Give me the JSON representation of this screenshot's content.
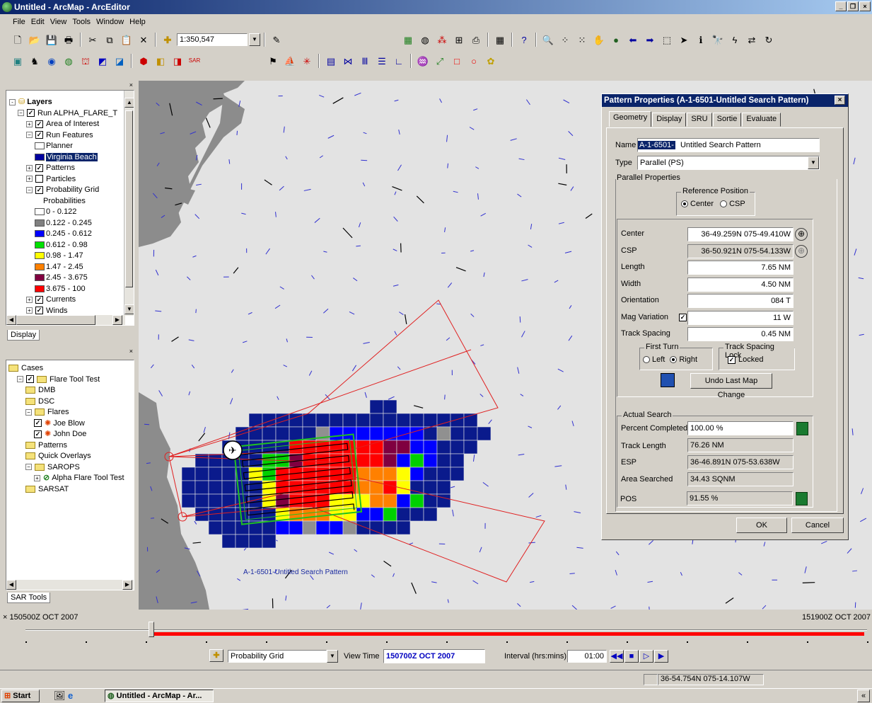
{
  "window": {
    "title": "Untitled - ArcMap - ArcEditor"
  },
  "menu": [
    "File",
    "Edit",
    "View",
    "Tools",
    "Window",
    "Help"
  ],
  "toolbar": {
    "scale": "1:350,547"
  },
  "layers": {
    "root": "Layers",
    "items": [
      {
        "label": "Run ALPHA_FLARE_T",
        "indent": 1,
        "pm": "-",
        "cb": "✓"
      },
      {
        "label": "Area of Interest",
        "indent": 2,
        "pm": "+",
        "cb": "✓"
      },
      {
        "label": "Run Features",
        "indent": 2,
        "pm": "-",
        "cb": "✓"
      },
      {
        "label": "Planner",
        "indent": 3,
        "swatch": "#ffffff"
      },
      {
        "label": "Virginia Beach",
        "indent": 3,
        "swatch": "#0000a0",
        "selected": true
      },
      {
        "label": "Patterns",
        "indent": 2,
        "pm": "+",
        "cb": "✓"
      },
      {
        "label": "Particles",
        "indent": 2,
        "pm": "+",
        "cb": ""
      },
      {
        "label": "Probability Grid",
        "indent": 2,
        "pm": "-",
        "cb": "✓"
      },
      {
        "label": "Probabilities",
        "indent": 4
      },
      {
        "label": "0 - 0.122",
        "indent": 3,
        "swatch": "#ffffff"
      },
      {
        "label": "0.122 - 0.245",
        "indent": 3,
        "swatch": "#808080"
      },
      {
        "label": "0.245 - 0.612",
        "indent": 3,
        "swatch": "#0000ff"
      },
      {
        "label": "0.612 - 0.98",
        "indent": 3,
        "swatch": "#00e000"
      },
      {
        "label": "0.98 - 1.47",
        "indent": 3,
        "swatch": "#ffff00"
      },
      {
        "label": "1.47 - 2.45",
        "indent": 3,
        "swatch": "#ff8000"
      },
      {
        "label": "2.45 - 3.675",
        "indent": 3,
        "swatch": "#800040"
      },
      {
        "label": "3.675 - 100",
        "indent": 3,
        "swatch": "#ff0000"
      },
      {
        "label": "Currents",
        "indent": 2,
        "pm": "+",
        "cb": "✓"
      },
      {
        "label": "Winds",
        "indent": 2,
        "pm": "+",
        "cb": "✓"
      }
    ],
    "tab": "Display"
  },
  "sar": {
    "items": [
      {
        "label": "Cases",
        "indent": 0,
        "type": "folder"
      },
      {
        "label": "Flare Tool Test",
        "indent": 1,
        "pm": "-",
        "cb": "✓",
        "type": "folder"
      },
      {
        "label": "DMB",
        "indent": 2,
        "type": "folder"
      },
      {
        "label": "DSC",
        "indent": 2,
        "type": "folder"
      },
      {
        "label": "Flares",
        "indent": 2,
        "pm": "-",
        "type": "folder"
      },
      {
        "label": "Joe Blow",
        "indent": 3,
        "cb": "✓",
        "type": "flare"
      },
      {
        "label": "John Doe",
        "indent": 3,
        "cb": "✓",
        "type": "flare"
      },
      {
        "label": "Patterns",
        "indent": 2,
        "type": "folder"
      },
      {
        "label": "Quick Overlays",
        "indent": 2,
        "type": "folder"
      },
      {
        "label": "SAROPS",
        "indent": 2,
        "pm": "-",
        "type": "folder"
      },
      {
        "label": "Alpha Flare Tool Test",
        "indent": 3,
        "pm": "+",
        "type": "run"
      },
      {
        "label": "SARSAT",
        "indent": 2,
        "type": "folder"
      }
    ],
    "tab": "SAR Tools"
  },
  "map": {
    "pattern_label": "A-1-6501-Untitled Search Pattern"
  },
  "dialog": {
    "title": "Pattern Properties (A-1-6501-Untitled Search Pattern)",
    "tabs": [
      "Geometry",
      "Display",
      "SRU",
      "Sortie",
      "Evaluate"
    ],
    "name_label": "Name",
    "name_id": "A-1-6501-",
    "name_value": "Untitled Search Pattern",
    "type_label": "Type",
    "type_value": "Parallel (PS)",
    "parallel_props": "Parallel Properties",
    "ref_pos": "Reference Position",
    "ref_center": "Center",
    "ref_csp": "CSP",
    "fields": [
      {
        "label": "Center",
        "value": "36-49.259N 075-49.410W"
      },
      {
        "label": "CSP",
        "value": "36-50.921N 075-54.133W",
        "ro": true
      },
      {
        "label": "Length",
        "value": "7.65 NM"
      },
      {
        "label": "Width",
        "value": "4.50 NM"
      },
      {
        "label": "Orientation",
        "value": "084 T"
      },
      {
        "label": "Mag Variation",
        "value": "11 W"
      },
      {
        "label": "Track Spacing",
        "value": "0.45 NM"
      }
    ],
    "first_turn": "First Turn",
    "left": "Left",
    "right": "Right",
    "ts_lock": "Track Spacing Lock",
    "locked": "Locked",
    "undo": "Undo Last Map Change",
    "actual_search": "Actual Search",
    "percent_label": "Percent Completed",
    "percent_value": "100.00 %",
    "track_length_label": "Track Length",
    "track_length_value": "76.26 NM",
    "esp_label": "ESP",
    "esp_value": "36-46.891N 075-53.638W",
    "area_label": "Area Searched",
    "area_value": "34.43 SQNM",
    "pos_label": "POS",
    "pos_value": "91.55 %",
    "ok": "OK",
    "cancel": "Cancel"
  },
  "timebar": {
    "start": "150500Z OCT 2007",
    "end": "151900Z OCT 2007",
    "layer": "Probability Grid",
    "view_time_label": "View Time",
    "view_time": "150700Z OCT 2007",
    "interval_label": "Interval (hrs:mins)",
    "interval": "01:00",
    "position": 0.01
  },
  "status": {
    "coords": "36-54.754N 075-14.107W"
  },
  "taskbar": {
    "start": "Start",
    "task": "Untitled - ArcMap - Ar...",
    "chev": "«"
  }
}
